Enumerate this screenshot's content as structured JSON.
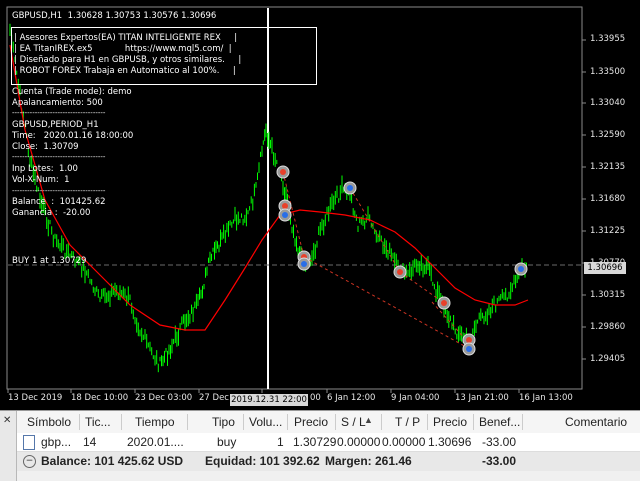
{
  "chart": {
    "symbol_header": "GBPUSD,H1  1.30628 1.30753 1.30576 1.30696",
    "info_box": [
      "| Asesores Expertos(EA) TITAN INTELIGENTE REX     |",
      "| EA TitanIREX.ex5            https://www.mql5.com/  |",
      "| Diseñado para H1 en GBPUSB, y otros similares.     |",
      "| ROBOT FOREX Trabaja en Automatico al 100%.     |"
    ],
    "account_mode": "Cuenta (Trade mode): demo",
    "leverage": "Apalancamiento: 500",
    "separator": "-------------------------------------",
    "period_title": "GBPUSD,PERIOD_H1",
    "time_line": "Time:   2020.01.16 18:00:00",
    "close_line": "Close:  1.30709",
    "inp_lotes": "Inp Lotes:  1.00",
    "vol_x_num": "Vol-X-Num:  1",
    "balance_line": "Balance  :  101425.62",
    "ganancia_line": "Ganancia :  -20.00",
    "position_label": "BUY 1 at 1.30729",
    "current_price": "1.30696",
    "cursor_date": "2019.12.31 22:00",
    "price_labels": [
      "1.33955",
      "1.33500",
      "1.33040",
      "1.32590",
      "1.32135",
      "1.31680",
      "1.31225",
      "1.30770",
      "1.30315",
      "1.29860",
      "1.29405"
    ],
    "time_labels": [
      "13 Dec 2019",
      "18 Dec 10:00",
      "23 Dec 03:00",
      "27 Dec",
      "6 Jan 12:00",
      "9 Jan 04:00",
      "13 Jan 21:00",
      "16 Jan 13:00"
    ],
    "time_label_suffix": "00",
    "colors": {
      "bull": "#00ff00",
      "bear": "#00ff00",
      "ma": "#ff0000",
      "background": "#000000",
      "grid": "#6a6a6a"
    }
  },
  "terminal": {
    "columns": [
      "Símbolo",
      "Tic...",
      "Tiempo",
      "Tipo",
      "Volu...",
      "Precio",
      "S / L",
      "T / P",
      "Precio",
      "Benef...",
      "Comentario"
    ],
    "sort_icon": "triangle-up-icon",
    "trade_row": {
      "symbol": "gbp...",
      "ticket": "14",
      "time": "2020.01....",
      "type": "buy",
      "volume": "1",
      "price_open": "1.30729",
      "sl": "0.00000",
      "tp": "0.00000",
      "price_current": "1.30696",
      "profit": "-33.00",
      "comment": ""
    },
    "summary": {
      "balance": "Balance: 101 425.62 USD",
      "equity": "Equidad: 101 392.62",
      "margin": "Margen: 261.46",
      "profit": "-33.00"
    }
  }
}
